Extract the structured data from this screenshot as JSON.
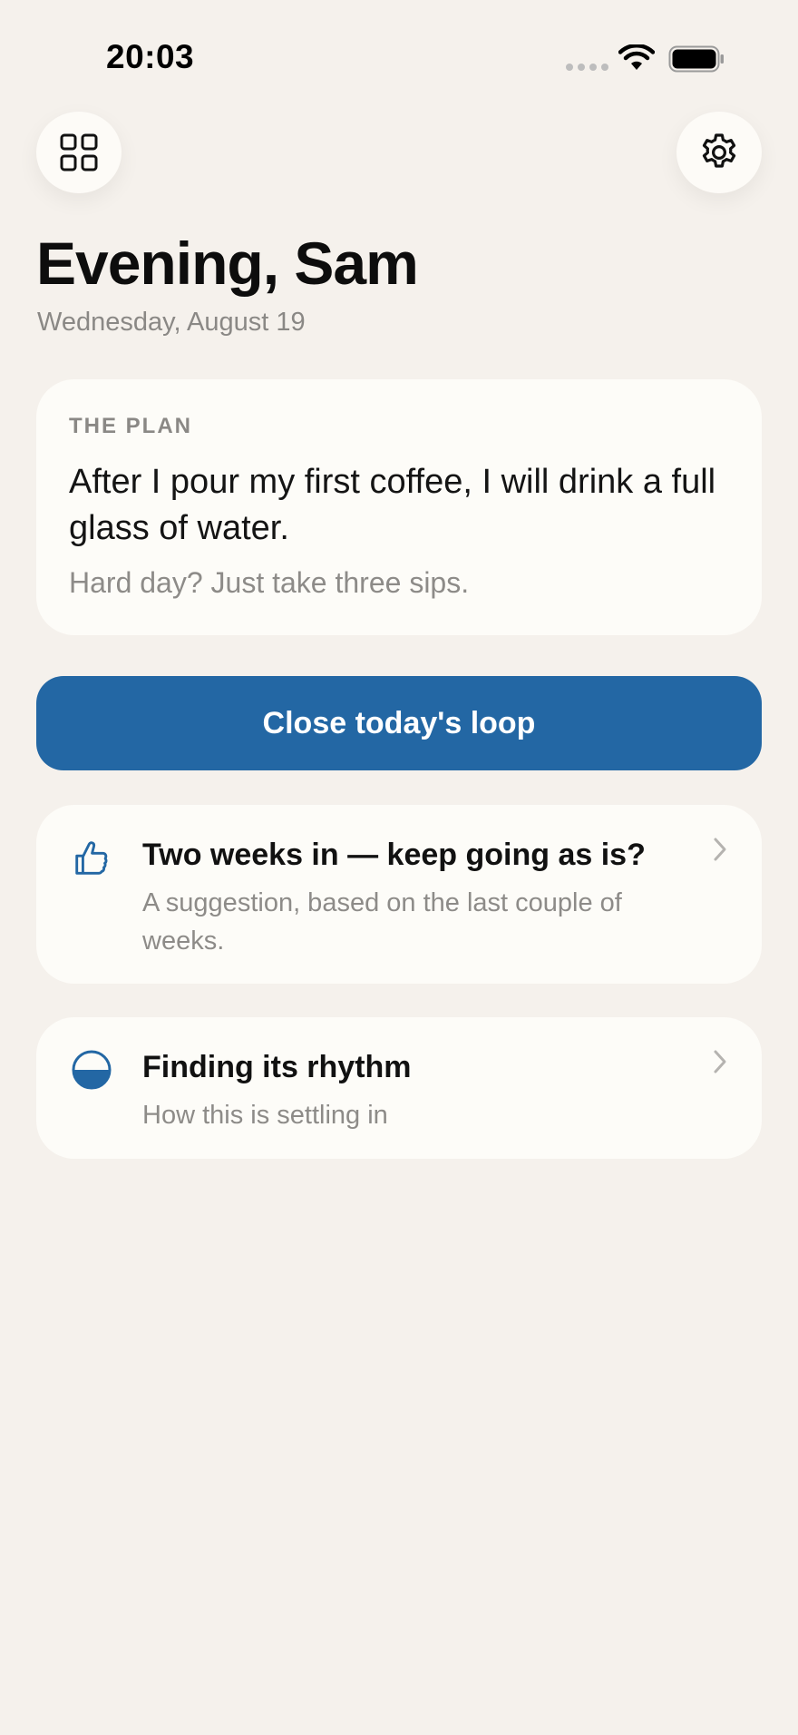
{
  "status_bar": {
    "time": "20:03"
  },
  "header": {
    "greeting": "Evening, Sam",
    "date": "Wednesday, August 19"
  },
  "plan_card": {
    "label": "THE PLAN",
    "text": "After I pour my first coffee, I will drink a full glass of water.",
    "fallback": "Hard day? Just take three sips."
  },
  "cta": {
    "label": "Close today's loop"
  },
  "suggestion_card": {
    "icon": "thumbs-up-icon",
    "title": "Two weeks in — keep going as is?",
    "subtitle": "A suggestion, based on the last couple of weeks."
  },
  "rhythm_card": {
    "icon": "half-circle-icon",
    "title": "Finding its rhythm",
    "subtitle": "How this is settling in"
  },
  "colors": {
    "background": "#f5f1ec",
    "card": "#fdfcf8",
    "accent": "#2367a4",
    "muted_text": "#8d8b88"
  }
}
